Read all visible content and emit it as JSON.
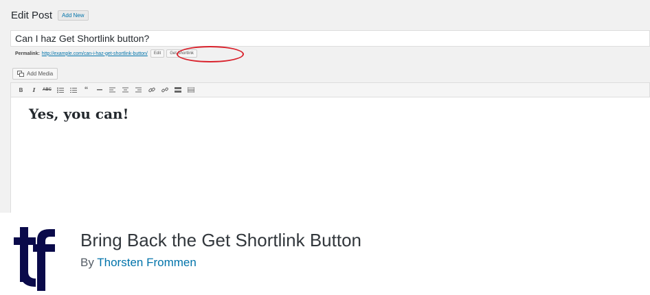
{
  "screenshot": {
    "page_title": "Edit Post",
    "add_new_label": "Add New",
    "post_title": "Can I haz Get Shortlink button?",
    "permalink": {
      "label": "Permalink:",
      "url": "http://example.com/can-i-haz-get-shortlink-button/",
      "edit_label": "Edit",
      "shortlink_label": "Get Shortlink"
    },
    "add_media_label": "Add Media",
    "toolbar": [
      "bold-icon",
      "italic-icon",
      "strikethrough-icon",
      "bullet-list-icon",
      "numbered-list-icon",
      "blockquote-icon",
      "horizontal-rule-icon",
      "align-left-icon",
      "align-center-icon",
      "align-right-icon",
      "link-icon",
      "unlink-icon",
      "read-more-icon",
      "toolbar-toggle-icon"
    ],
    "editor_content": "Yes, you can!"
  },
  "plugin": {
    "title": "Bring Back the Get Shortlink Button",
    "by": "By",
    "author": "Thorsten Frommen"
  },
  "colors": {
    "accent": "#0073aa",
    "highlight": "#d9202a",
    "logo": "#0a0a4a"
  }
}
